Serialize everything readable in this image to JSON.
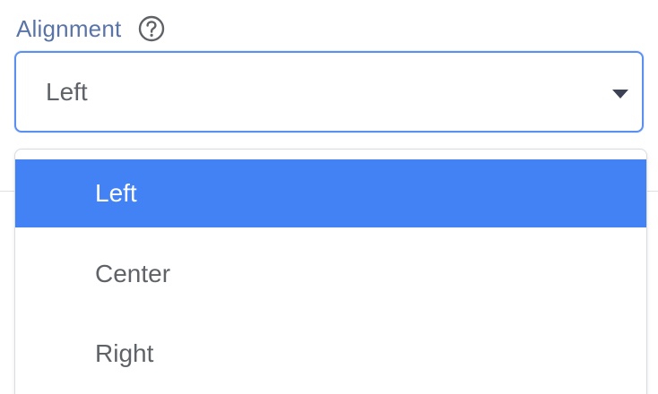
{
  "field": {
    "label": "Alignment",
    "help_icon": "question-circle-icon",
    "label_color": "#5a74a6"
  },
  "select": {
    "value": "Left",
    "caret_icon": "caret-down-icon",
    "border_color": "#5b8ff0"
  },
  "dropdown": {
    "options": [
      {
        "label": "Left",
        "selected": true
      },
      {
        "label": "Center",
        "selected": false
      },
      {
        "label": "Right",
        "selected": false
      }
    ],
    "selected_color": "#4382f5"
  }
}
